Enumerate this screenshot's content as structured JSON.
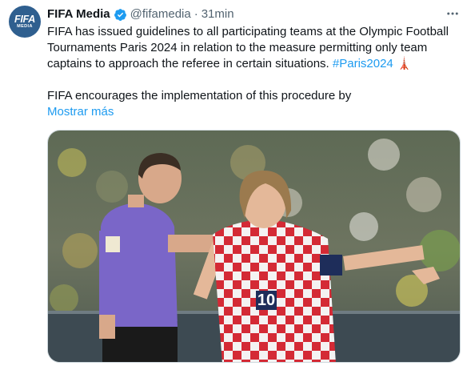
{
  "tweet": {
    "author_name": "FIFA Media",
    "handle": "@fifamedia",
    "separator": "·",
    "time": "31min",
    "avatar_line1": "FIFA",
    "avatar_line2": "MEDIA",
    "text_line1_pre": "FIFA has issued guidelines to all participating teams at the Olympic Football Tournaments Paris 2024 in relation to the measure permitting only team captains to approach the referee in certain situations. ",
    "hashtag": "#Paris2024",
    "hashtag_emoji": "🗼",
    "text_line2": "FIFA encourages the implementation of this procedure by",
    "show_more": "Mostrar más"
  },
  "media": {
    "description_icon": "photo",
    "player_number": "10"
  },
  "colors": {
    "accent": "#1d9bf0",
    "text": "#0f1419",
    "secondary": "#536471",
    "verified": "#1d9bf0"
  }
}
